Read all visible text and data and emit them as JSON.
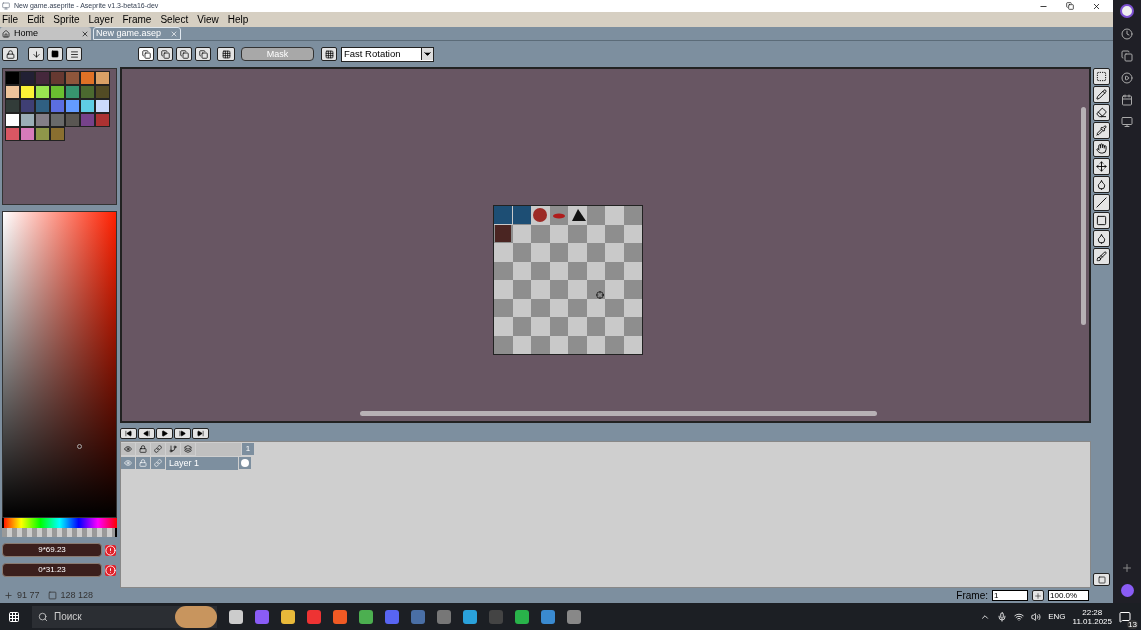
{
  "window": {
    "title": "New game.aseprite - Aseprite v1.3-beta16-dev"
  },
  "menu": [
    "File",
    "Edit",
    "Sprite",
    "Layer",
    "Frame",
    "Select",
    "View",
    "Help"
  ],
  "tabs": [
    {
      "label": "Home",
      "selected": false
    },
    {
      "label": "New game.asep",
      "selected": true
    }
  ],
  "toolbar": {
    "mask_button": "Mask",
    "rotation_algorithm": "Fast Rotation"
  },
  "palette": [
    {
      "color": "#000000"
    },
    {
      "color": "#222034"
    },
    {
      "color": "#45283c"
    },
    {
      "color": "#663931"
    },
    {
      "color": "#8f563b"
    },
    {
      "color": "#df7126"
    },
    {
      "color": "#d9a066"
    },
    {
      "color": "#eec39a"
    },
    {
      "color": "#fbf236"
    },
    {
      "color": "#99e550"
    },
    {
      "color": "#6abe30"
    },
    {
      "color": "#37946e"
    },
    {
      "color": "#4b692f"
    },
    {
      "color": "#524b24"
    },
    {
      "color": "#323c39"
    },
    {
      "color": "#3f3f74"
    },
    {
      "color": "#306082"
    },
    {
      "color": "#5b6ee1"
    },
    {
      "color": "#639bff"
    },
    {
      "color": "#5fcde4"
    },
    {
      "color": "#cbdbfc"
    },
    {
      "color": "#ffffff"
    },
    {
      "color": "#9badb7"
    },
    {
      "color": "#847e87"
    },
    {
      "color": "#696a6a"
    },
    {
      "color": "#595652"
    },
    {
      "color": "#76428a"
    },
    {
      "color": "#ac3232"
    },
    {
      "color": "#d95763"
    },
    {
      "color": "#d77bba"
    },
    {
      "color": "#8f974a"
    },
    {
      "color": "#8a6f30"
    }
  ],
  "hue_slider": {
    "level": 0.0
  },
  "alpha_slider": {
    "level": 1.0
  },
  "color_fields": [
    {
      "value": "9*69.23"
    },
    {
      "value": "0*31.23"
    }
  ],
  "status_bar": {
    "cursor_position": "91 77",
    "sprite_size": "128 128"
  },
  "timeline": {
    "frames": [
      {
        "label": "1"
      }
    ],
    "layers": [
      {
        "name": "Layer 1",
        "selected": true
      }
    ]
  },
  "frame_controls": {
    "label": "Frame:",
    "frame": "1",
    "zoom": "100.0%"
  },
  "taskbar": {
    "search_placeholder": "Поиск",
    "language": "ENG",
    "time": "22:28",
    "date": "11.01.2025",
    "notifications": "13"
  }
}
